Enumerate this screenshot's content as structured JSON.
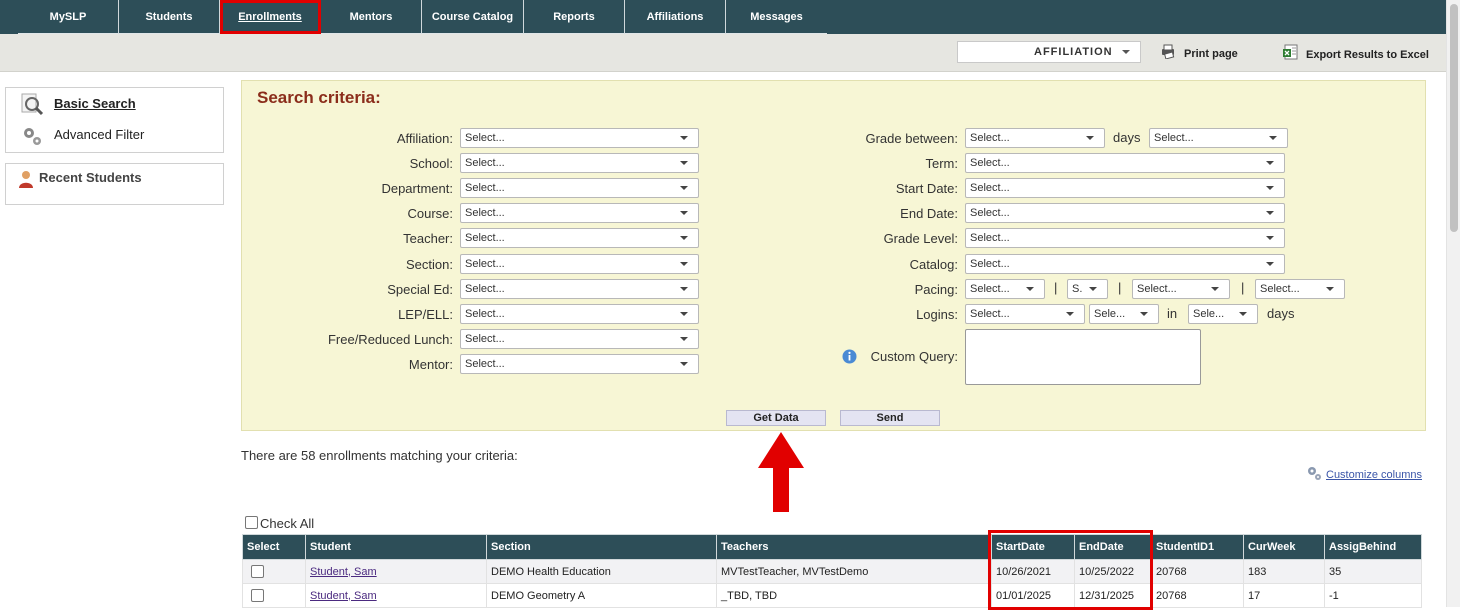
{
  "nav": {
    "items": [
      "MySLP",
      "Students",
      "Enrollments",
      "Mentors",
      "Course Catalog",
      "Reports",
      "Affiliations",
      "Messages"
    ],
    "active": "Enrollments"
  },
  "toolbar": {
    "affiliation_label": "AFFILIATION",
    "print_label": "Print page",
    "export_label": "Export Results to Excel"
  },
  "sidebar": {
    "basic_search": "Basic Search",
    "advanced_filter": "Advanced Filter",
    "recent_students": "Recent Students"
  },
  "criteria": {
    "title": "Search criteria:",
    "placeholder": "Select...",
    "left_labels": [
      "Affiliation:",
      "School:",
      "Department:",
      "Course:",
      "Teacher:",
      "Section:",
      "Special Ed:",
      "LEP/ELL:",
      "Free/Reduced Lunch:",
      "Mentor:"
    ],
    "grade_between_label": "Grade between:",
    "days_label": "days",
    "term_label": "Term:",
    "start_date_label": "Start Date:",
    "end_date_label": "End Date:",
    "grade_level_label": "Grade Level:",
    "catalog_label": "Catalog:",
    "pacing_label": "Pacing:",
    "logins_label": "Logins:",
    "in_label": "in",
    "custom_query_label": "Custom Query:",
    "pacing_short_1": "S.",
    "logins_short_1": "Sele...",
    "logins_short_2": "Sele...",
    "pipe": "|",
    "get_data": "Get Data",
    "send": "Send"
  },
  "results": {
    "count_text": "There are 58 enrollments matching your criteria:",
    "customize_columns": "Customize columns",
    "check_all": "Check All",
    "headers": [
      "Select",
      "Student",
      "Section",
      "Teachers",
      "StartDate",
      "EndDate",
      "StudentID1",
      "CurWeek",
      "AssigBehind"
    ],
    "rows": [
      {
        "student": "Student, Sam",
        "section": "DEMO Health Education",
        "teachers": "MVTestTeacher, MVTestDemo",
        "start": "10/26/2021",
        "end": "10/25/2022",
        "sid": "20768",
        "week": "183",
        "behind": "35"
      },
      {
        "student": "Student, Sam",
        "section": "DEMO Geometry A",
        "teachers": "_TBD, TBD",
        "start": "01/01/2025",
        "end": "12/31/2025",
        "sid": "20768",
        "week": "17",
        "behind": "-1"
      }
    ]
  },
  "colors": {
    "nav_bg": "#2d4e58",
    "criteria_bg": "#f7f6d5",
    "title_color": "#8b2d1b",
    "highlight_red": "#e10000"
  }
}
